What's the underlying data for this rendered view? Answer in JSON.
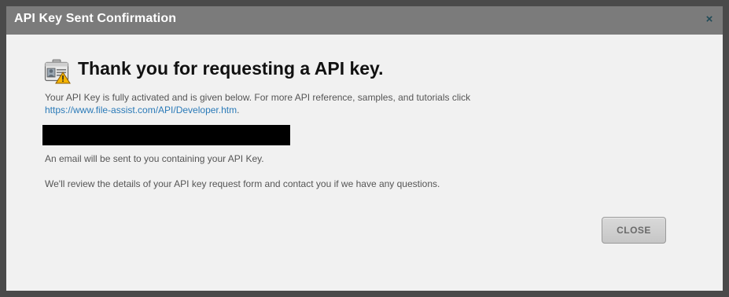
{
  "dialog": {
    "title": "API Key Sent Confirmation",
    "close_glyph": "×",
    "heading": "Thank you for requesting a  API key.",
    "heading_icon": "id-card-warning-icon",
    "intro_text": "Your API Key is fully activated and is given below.  For more API reference, samples, and tutorials click",
    "link_text": "https://www.file-assist.com/API/Developer.htm",
    "link_suffix": ".",
    "email_note": "An email will be sent to you containing your API Key.",
    "review_note": "We'll review the details of your API key request form and contact you if we have any questions.",
    "close_button_label": "CLOSE"
  },
  "colors": {
    "overlay": "#4a4a4a",
    "titlebar": "#7b7b7b",
    "dialog_bg": "#f1f1f1",
    "link": "#2a7ab8",
    "redaction": "#000000"
  }
}
